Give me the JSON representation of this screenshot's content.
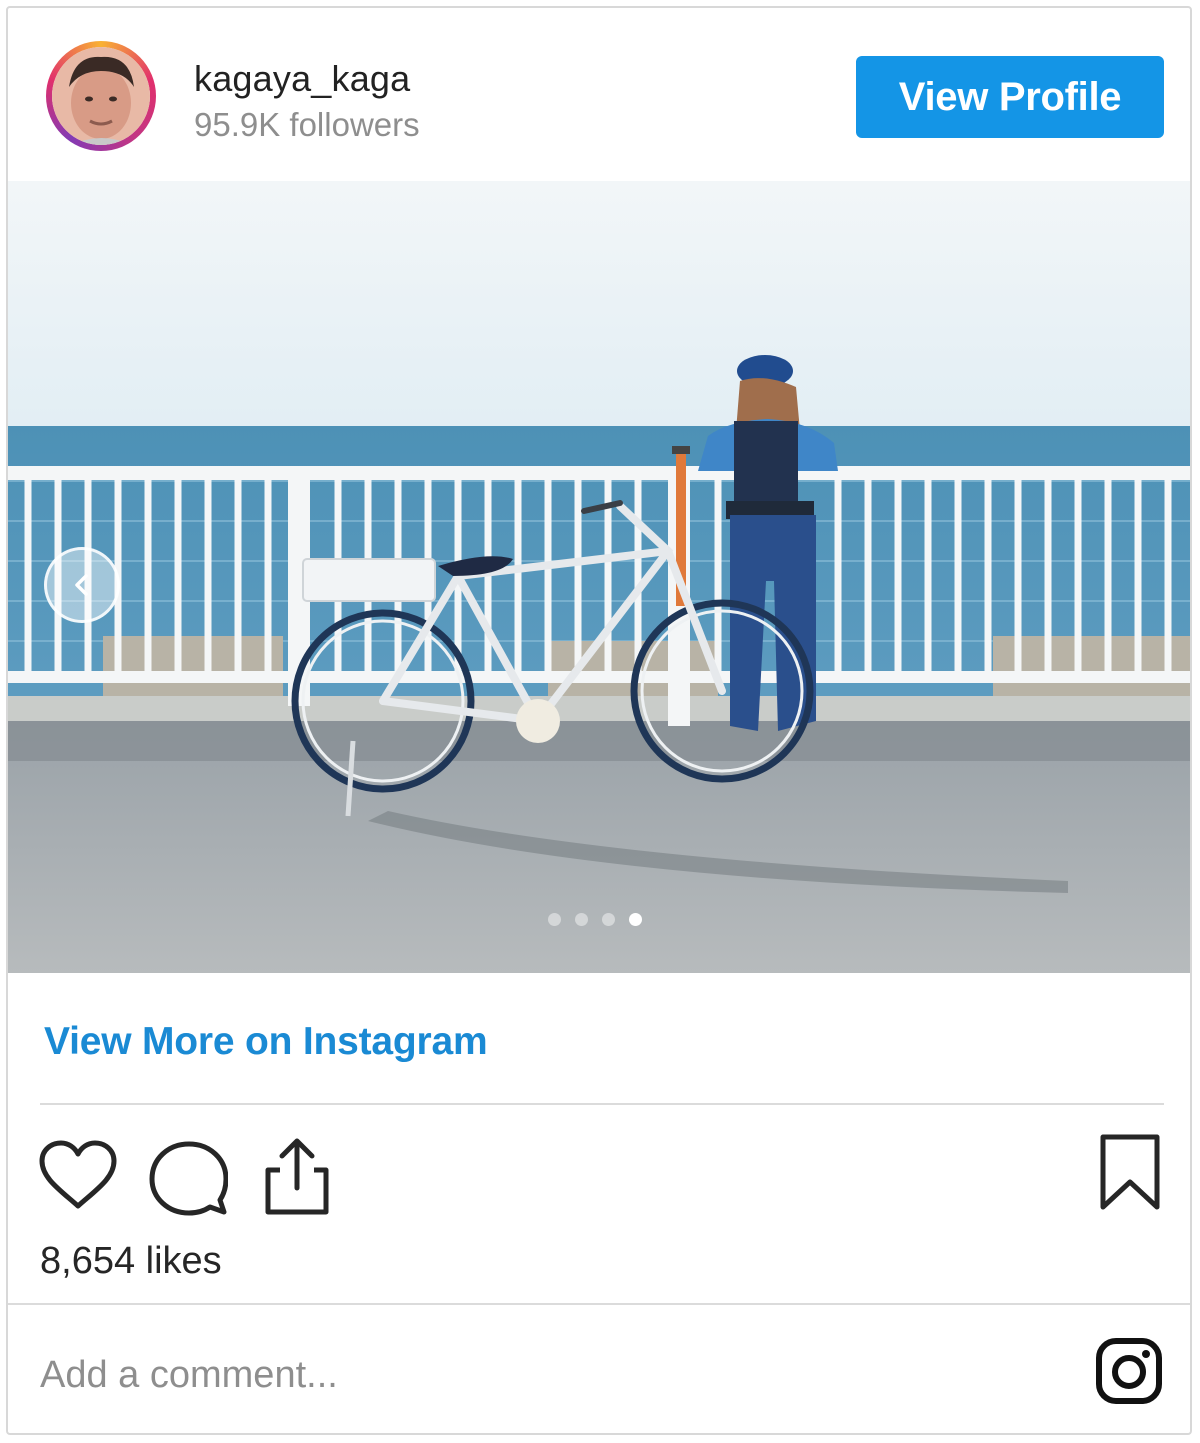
{
  "header": {
    "username": "kagaya_kaga",
    "followers": "95.9K followers",
    "view_profile_label": "View Profile"
  },
  "post": {
    "carousel": {
      "slide_count": 4,
      "active_slide": 4
    }
  },
  "view_more_label": "View More on Instagram",
  "likes": "8,654 likes",
  "comment_placeholder": "Add a comment...",
  "icons": [
    "heart-icon",
    "comment-icon",
    "share-icon",
    "bookmark-icon",
    "instagram-icon",
    "chevron-left-icon"
  ],
  "colors": {
    "accent": "#1495e6",
    "link": "#1a8ad4",
    "muted": "#8e8e8e"
  }
}
